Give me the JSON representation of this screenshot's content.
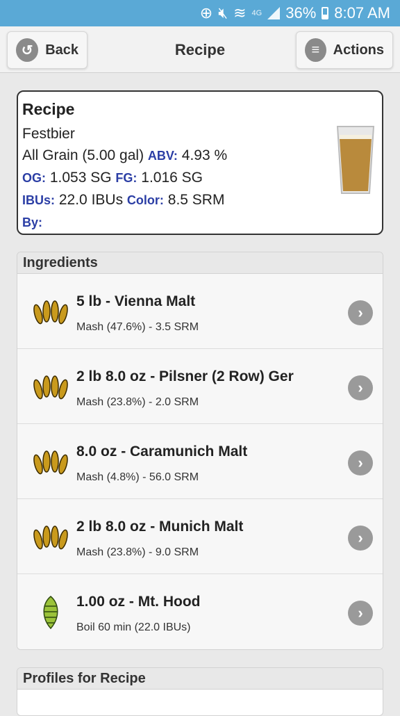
{
  "status_bar": {
    "battery": "36%",
    "time": "8:07 AM",
    "network": "4G"
  },
  "header": {
    "back_label": "Back",
    "title": "Recipe",
    "actions_label": "Actions"
  },
  "recipe": {
    "heading": "Recipe",
    "name": "Festbier",
    "type_size": "All Grain (5.00 gal)",
    "abv_label": "ABV:",
    "abv_value": "4.93 %",
    "og_label": "OG:",
    "og_value": "1.053 SG",
    "fg_label": "FG:",
    "fg_value": "1.016 SG",
    "ibu_label": "IBUs:",
    "ibu_value": "22.0 IBUs",
    "color_label": "Color:",
    "color_value": "8.5 SRM",
    "by_label": "By:"
  },
  "ingredients": {
    "heading": "Ingredients",
    "items": [
      {
        "icon": "grain-icon",
        "name": "5 lb - Vienna Malt",
        "detail": "Mash (47.6%) - 3.5 SRM"
      },
      {
        "icon": "grain-icon",
        "name": "2 lb 8.0 oz - Pilsner (2 Row) Ger",
        "detail": "Mash (23.8%) - 2.0 SRM"
      },
      {
        "icon": "grain-icon",
        "name": "8.0 oz - Caramunich Malt",
        "detail": "Mash (4.8%) - 56.0 SRM"
      },
      {
        "icon": "grain-icon",
        "name": "2 lb 8.0 oz - Munich Malt",
        "detail": "Mash (23.8%) - 9.0 SRM"
      },
      {
        "icon": "hop-icon",
        "name": "1.00 oz - Mt. Hood",
        "detail": "Boil 60 min (22.0 IBUs)"
      }
    ]
  },
  "profiles": {
    "heading": "Profiles for Recipe"
  },
  "colors": {
    "status_bar": "#5aa9d6",
    "label_blue": "#2b3ea5",
    "beer": "#b98a3c"
  }
}
